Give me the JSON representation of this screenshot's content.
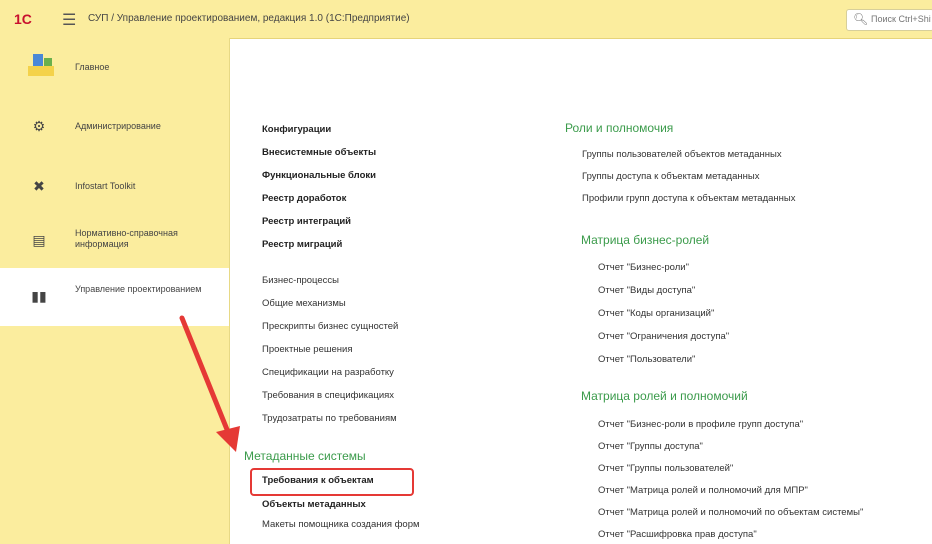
{
  "header": {
    "logo": "1C",
    "title": "СУП / Управление проектированием, редакция 1.0 (1С:Предприятие)",
    "search_placeholder": "Поиск Ctrl+Shift+F"
  },
  "sidebar": {
    "items": [
      {
        "label": "Главное",
        "icon": "home-icon"
      },
      {
        "label": "Администрирование",
        "icon": "gear-icon"
      },
      {
        "label": "Infostart Toolkit",
        "icon": "tools-icon"
      },
      {
        "label": "Нормативно-справочная информация",
        "icon": "cabinet-icon"
      },
      {
        "label": "Управление проектированием",
        "icon": "structure-icon"
      }
    ]
  },
  "col1": {
    "group1": [
      "Конфигурации",
      "Внесистемные объекты",
      "Функциональные блоки",
      "Реестр доработок",
      "Реестр интеграций",
      "Реестр миграций"
    ],
    "group2": [
      "Бизнес-процессы",
      "Общие механизмы",
      "Прескрипты бизнес сущностей",
      "Проектные решения",
      "Спецификации на разработку",
      "Требования в спецификациях",
      "Трудозатраты по требованиям"
    ],
    "section_meta": "Метаданные системы",
    "meta": [
      "Требования к объектам",
      "Объекты метаданных",
      "Макеты помощника создания форм"
    ]
  },
  "col2": {
    "section_roles": "Роли и полномочия",
    "roles": [
      "Группы пользователей объектов метаданных",
      "Группы доступа к объектам метаданных",
      "Профили групп доступа к объектам метаданных"
    ],
    "section_matrix": "Матрица бизнес-ролей",
    "matrix": [
      "Отчет \"Бизнес-роли\"",
      "Отчет \"Виды доступа\"",
      "Отчет \"Коды организаций\"",
      "Отчет \"Ограничения доступа\"",
      "Отчет \"Пользователи\""
    ],
    "section_matrix2": "Матрица ролей и полномочий",
    "matrix2": [
      "Отчет \"Бизнес-роли в профиле групп доступа\"",
      "Отчет \"Группы доступа\"",
      "Отчет \"Группы пользователей\"",
      "Отчет \"Матрица ролей и полномочий для МПР\"",
      "Отчет \"Матрица ролей и полномочий по объектам системы\"",
      "Отчет \"Расшифровка прав доступа\""
    ]
  },
  "colors": {
    "accent_green": "#3b9b4b",
    "highlight_red": "#e53935",
    "sidebar_bg": "#fbed9e"
  }
}
